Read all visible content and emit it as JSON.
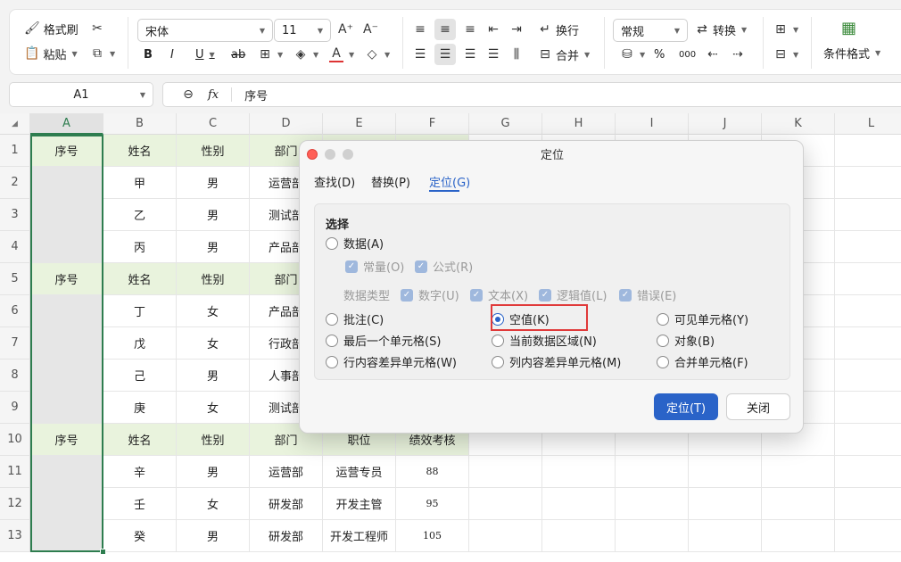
{
  "ribbon": {
    "format_painter": "格式刷",
    "paste": "粘贴",
    "font_name": "宋体",
    "font_size": "11",
    "bold": "B",
    "italic": "I",
    "underline": "U",
    "strike": "ab",
    "wrap": "换行",
    "merge": "合并",
    "number_format": "常规",
    "convert": "转换",
    "percent": "%",
    "thousands": "000",
    "cond_format": "条件格式"
  },
  "formula_bar": {
    "cell_ref": "A1",
    "fx": "fx",
    "content": "序号"
  },
  "sheet": {
    "columns": [
      "A",
      "B",
      "C",
      "D",
      "E",
      "F",
      "G",
      "H",
      "I",
      "J",
      "K",
      "L"
    ],
    "row_numbers": [
      "1",
      "2",
      "3",
      "4",
      "5",
      "6",
      "7",
      "8",
      "9",
      "10",
      "11",
      "12",
      "13"
    ],
    "rows": [
      [
        "序号",
        "姓名",
        "性别",
        "部门",
        "",
        ""
      ],
      [
        "",
        "甲",
        "男",
        "运营部",
        "",
        ""
      ],
      [
        "",
        "乙",
        "男",
        "测试部",
        "",
        ""
      ],
      [
        "",
        "丙",
        "男",
        "产品部",
        "",
        ""
      ],
      [
        "序号",
        "姓名",
        "性别",
        "部门",
        "",
        ""
      ],
      [
        "",
        "丁",
        "女",
        "产品部",
        "",
        ""
      ],
      [
        "",
        "戊",
        "女",
        "行政部",
        "",
        ""
      ],
      [
        "",
        "己",
        "男",
        "人事部",
        "",
        ""
      ],
      [
        "",
        "庚",
        "女",
        "测试部",
        "",
        ""
      ],
      [
        "序号",
        "姓名",
        "性别",
        "部门",
        "职位",
        "绩效考核"
      ],
      [
        "",
        "辛",
        "男",
        "运营部",
        "运营专员",
        "88"
      ],
      [
        "",
        "壬",
        "女",
        "研发部",
        "开发主管",
        "95"
      ],
      [
        "",
        "癸",
        "男",
        "研发部",
        "开发工程师",
        "105"
      ]
    ]
  },
  "dialog": {
    "title": "定位",
    "tabs": [
      "查找(D)",
      "替换(P)",
      "定位(G)"
    ],
    "active_tab": "定位(G)",
    "section_label": "选择",
    "data_option": "数据(A)",
    "constants": "常量(O)",
    "formulas": "公式(R)",
    "data_type_label": "数据类型",
    "number": "数字(U)",
    "text": "文本(X)",
    "logical": "逻辑值(L)",
    "errors": "错误(E)",
    "options": [
      [
        "批注(C)",
        "空值(K)",
        "可见单元格(Y)"
      ],
      [
        "最后一个单元格(S)",
        "当前数据区域(N)",
        "对象(B)"
      ],
      [
        "行内容差异单元格(W)",
        "列内容差异单元格(M)",
        "合并单元格(F)"
      ]
    ],
    "selected_option": "空值(K)",
    "ok_button": "定位(T)",
    "close_button": "关闭"
  },
  "colors": {
    "accent": "#2a63c8",
    "header_fill": "#e9f3dd",
    "selection_border": "#2e7d4f",
    "highlight": "#e03a3a"
  }
}
